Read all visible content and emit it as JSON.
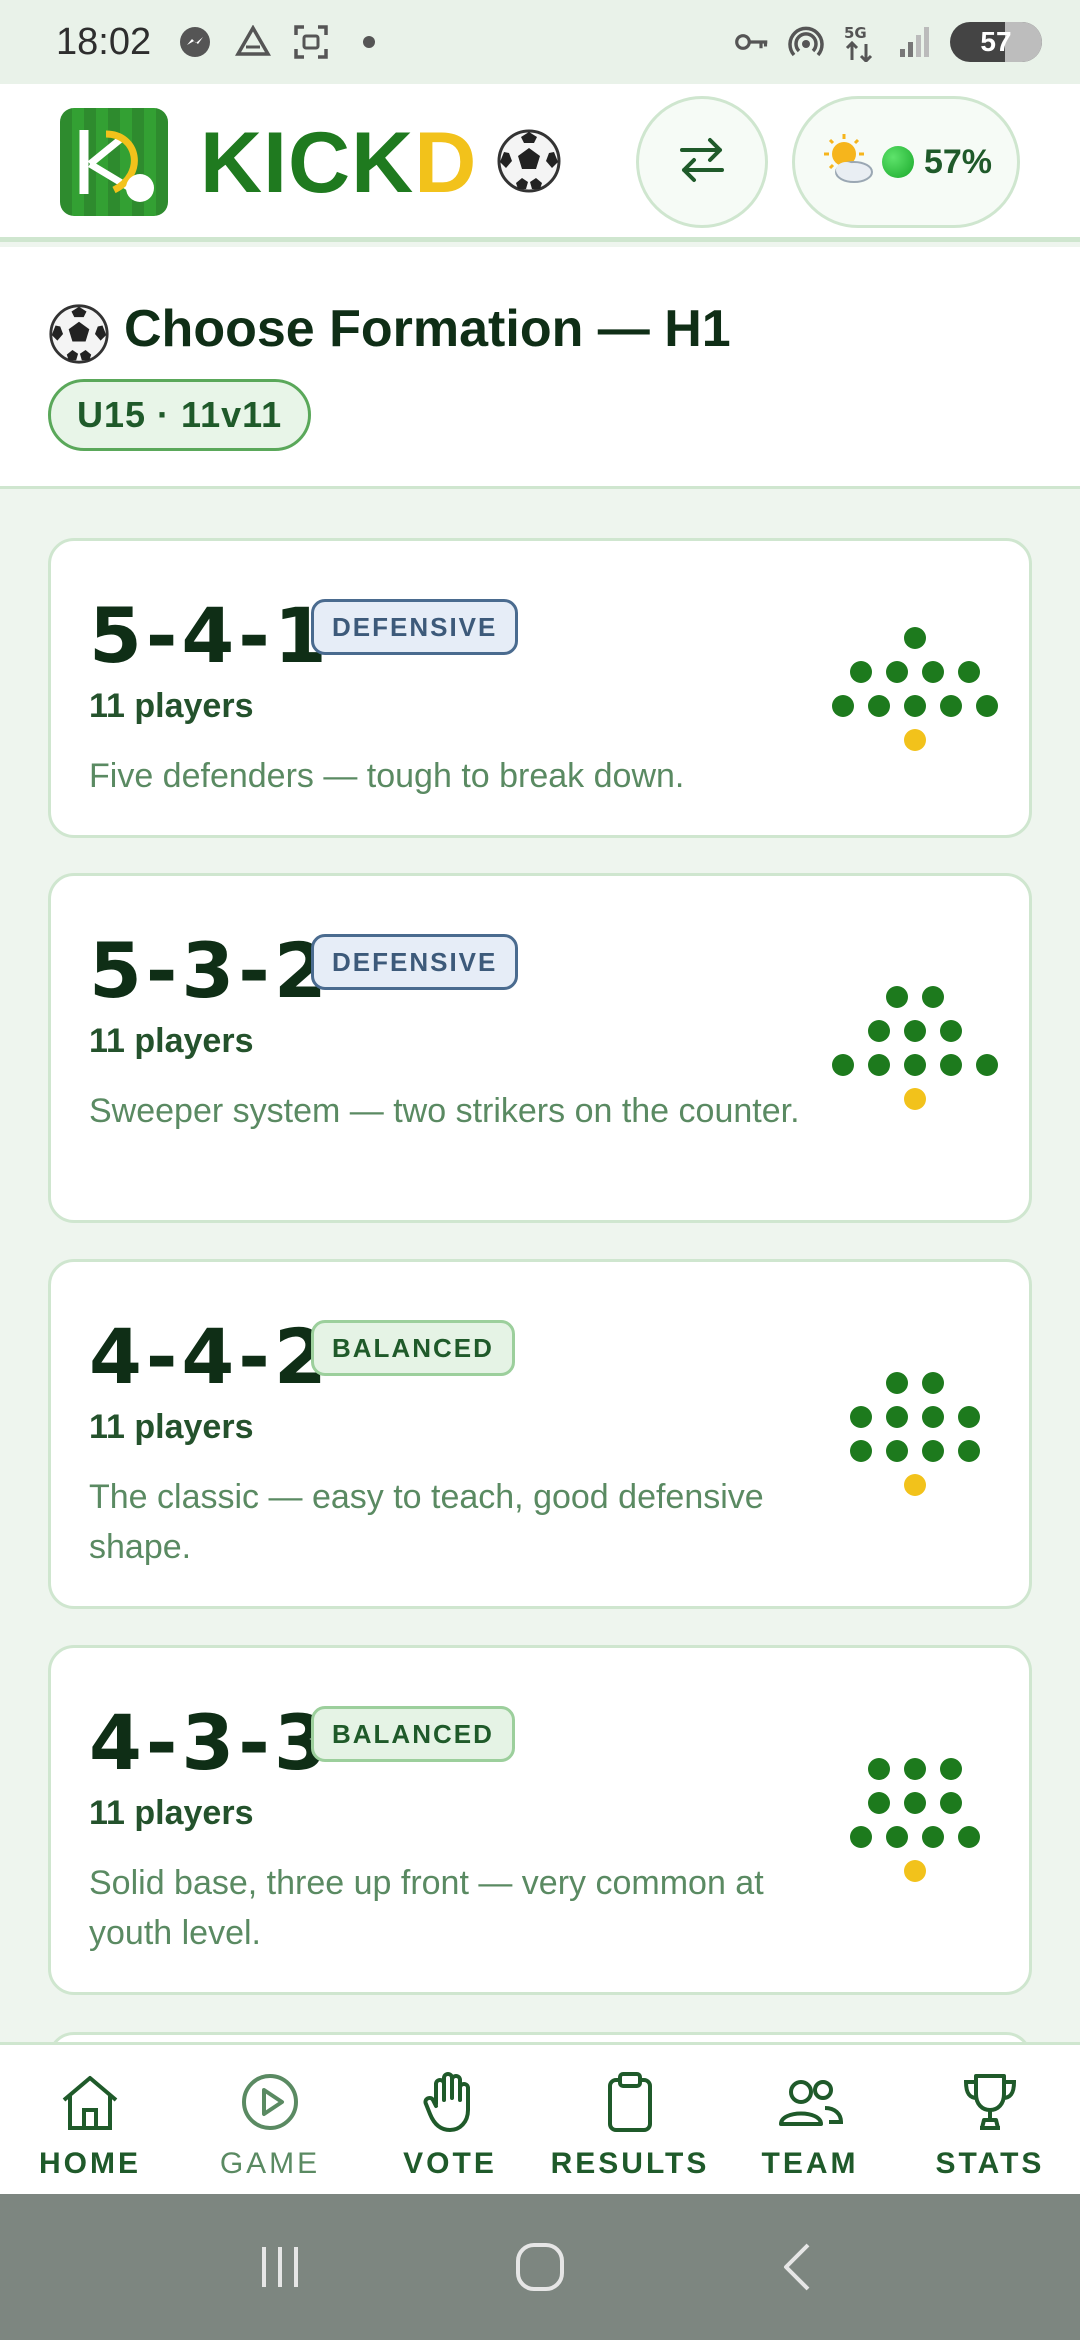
{
  "status_bar": {
    "time": "18:02",
    "battery": "57",
    "left_icons": [
      "messenger-icon",
      "drive-icon",
      "screenshot-icon",
      "dot-icon"
    ],
    "right_icons": [
      "key-icon",
      "hotspot-icon",
      "5g-icon",
      "signal-icon"
    ]
  },
  "header": {
    "brand_part1": "KICK",
    "brand_part2": "D",
    "weather_pct": "57%",
    "brand_color": "#1f7a1f",
    "accent_color": "#f2c21b"
  },
  "title": {
    "text": "Choose Formation — H1",
    "chip": "U15 · 11v11"
  },
  "formations": [
    {
      "name": "5-4-1",
      "tag": "DEFENSIVE",
      "tag_style": "defensive",
      "players": "11 players",
      "desc": "Five defenders — tough to break down.",
      "rows": [
        1,
        4,
        5
      ]
    },
    {
      "name": "5-3-2",
      "tag": "DEFENSIVE",
      "tag_style": "defensive",
      "players": "11 players",
      "desc": "Sweeper system — two strikers on the counter.",
      "rows": [
        2,
        3,
        5
      ]
    },
    {
      "name": "4-4-2",
      "tag": "BALANCED",
      "tag_style": "balanced",
      "players": "11 players",
      "desc": "The classic — easy to teach, good defensive shape.",
      "rows": [
        2,
        4,
        4
      ]
    },
    {
      "name": "4-3-3",
      "tag": "BALANCED",
      "tag_style": "balanced",
      "players": "11 players",
      "desc": "Solid base, three up front — very common at youth level.",
      "rows": [
        3,
        3,
        4
      ]
    }
  ],
  "nav": [
    {
      "label": "HOME",
      "icon": "home-icon"
    },
    {
      "label": "GAME",
      "icon": "play-icon"
    },
    {
      "label": "VOTE",
      "icon": "hand-icon"
    },
    {
      "label": "RESULTS",
      "icon": "clipboard-icon"
    },
    {
      "label": "TEAM",
      "icon": "people-icon"
    },
    {
      "label": "STATS",
      "icon": "trophy-icon"
    }
  ]
}
